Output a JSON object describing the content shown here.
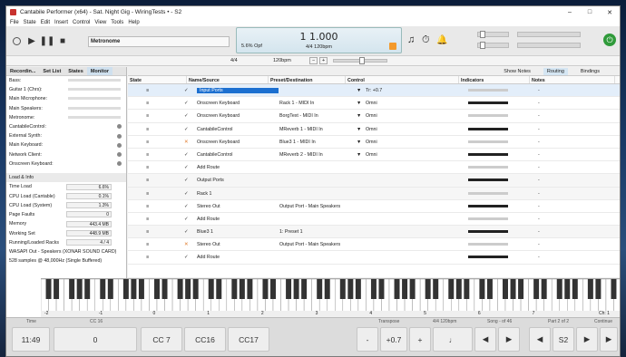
{
  "title": "Cantabile Performer (x64) - Sat. Night Gig - WiringTests • - S2",
  "menu": [
    "File",
    "State",
    "Edit",
    "Insert",
    "Control",
    "View",
    "Tools",
    "Help"
  ],
  "song_label": "Metronome",
  "position": "1 1.000",
  "cpu": "5.6% Opf",
  "tempo_display": "4/4 120bpm",
  "timesig": "4/4",
  "bpm": "120bpm",
  "left_tabs": [
    "Recordin...",
    "Set List",
    "States",
    "Monitor"
  ],
  "ports": [
    "Bass:",
    "Guitar 1 (Chrs):",
    "Main Microphone:",
    "Main Speakers:",
    "Metronome:",
    "CantabileControl:",
    "External Synth:",
    "Main Keyboard:",
    "Network Client:",
    "Onscreen Keyboard:"
  ],
  "info_title": "Load & Info",
  "info": [
    {
      "k": "Time Load",
      "v": "6.6%"
    },
    {
      "k": "CPU Load (Cantable)",
      "v": "0.1%"
    },
    {
      "k": "CPU Load (System)",
      "v": "1.3%"
    },
    {
      "k": "Page Faults",
      "v": "0"
    },
    {
      "k": "Memory",
      "v": "443.4 MB"
    },
    {
      "k": "Working Set",
      "v": "448.9 MB"
    },
    {
      "k": "Running/Loaded Racks",
      "v": "4 / 4"
    }
  ],
  "audio": "WASAPI Out - Speakers (XONAR SOUND CARD)",
  "samples": "528 samples @ 48,000Hz (Single Buffered)",
  "right_tabs": [
    "Show Notes",
    "Routing",
    "Bindings"
  ],
  "cols": [
    "State",
    "Name/Source",
    "Preset/Destination",
    "Control",
    "Indicators",
    "Notes"
  ],
  "rows": [
    {
      "n": "Input Ports",
      "p": "",
      "k": "Tr: +0.7",
      "sel": true
    },
    {
      "n": "Onscreen Keyboard",
      "p": "Rack 1 - MIDI In",
      "k": "Omni"
    },
    {
      "n": "Onscreen Keyboard",
      "p": "BorgText - MIDI In",
      "k": "Omni"
    },
    {
      "n": "CantabileControl",
      "p": "MReverb 1 - MIDI In",
      "k": "Omni"
    },
    {
      "n": "Onscreen Keyboard",
      "p": "Blue3 1 - MIDI In",
      "k": "Omni",
      "x": true
    },
    {
      "n": "CantabileControl",
      "p": "MReverb 2 - MIDI In",
      "k": "Omni"
    },
    {
      "n": "Add Route",
      "p": "",
      "k": ""
    },
    {
      "n": "Output Ports",
      "p": "",
      "k": ""
    },
    {
      "n": "Rack 1",
      "p": "",
      "k": ""
    },
    {
      "n": "Stereo Out",
      "p": "Output Port - Main Speakers",
      "k": ""
    },
    {
      "n": "Add Route",
      "p": "",
      "k": ""
    },
    {
      "n": "Blue3 1",
      "p": "1: Preset 1",
      "k": ""
    },
    {
      "n": "Stereo Out",
      "p": "Output Port - Main Speakers",
      "k": "",
      "x": true
    },
    {
      "n": "Add Route",
      "p": "",
      "k": ""
    }
  ],
  "kb_labels": [
    "-2",
    "-1",
    "0",
    "1",
    "2",
    "3",
    "4",
    "5",
    "6",
    "7",
    "Ch: 1"
  ],
  "bottom_labels": {
    "time": "Time",
    "cc16": "CC 16",
    "transpose": "Transpose",
    "ts": "4/4 120bpm",
    "song": "Song - of 46",
    "part": "Part 2 of 2",
    "cont": "Continue"
  },
  "bottom": {
    "time": "11:49",
    "v0": "0",
    "cc7": "CC 7",
    "cc16": "CC16",
    "cc17": "CC17",
    "minus": "-",
    "tr": "+0.7",
    "plus": "+",
    "s2": "S2"
  }
}
